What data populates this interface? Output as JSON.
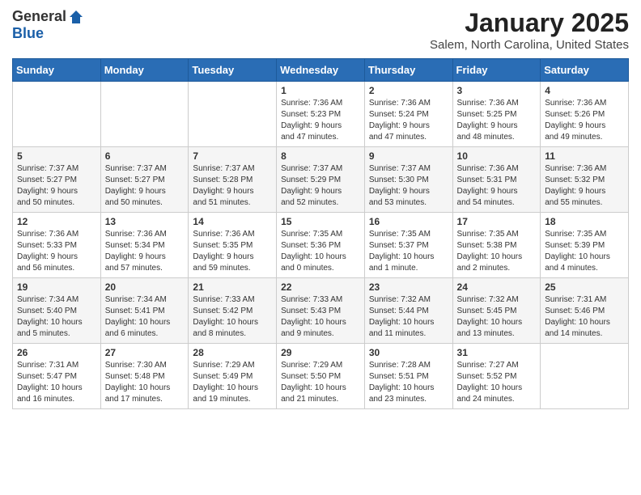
{
  "header": {
    "logo_general": "General",
    "logo_blue": "Blue",
    "month_title": "January 2025",
    "location": "Salem, North Carolina, United States"
  },
  "days_of_week": [
    "Sunday",
    "Monday",
    "Tuesday",
    "Wednesday",
    "Thursday",
    "Friday",
    "Saturday"
  ],
  "weeks": [
    [
      {
        "day": "",
        "info": ""
      },
      {
        "day": "",
        "info": ""
      },
      {
        "day": "",
        "info": ""
      },
      {
        "day": "1",
        "info": "Sunrise: 7:36 AM\nSunset: 5:23 PM\nDaylight: 9 hours\nand 47 minutes."
      },
      {
        "day": "2",
        "info": "Sunrise: 7:36 AM\nSunset: 5:24 PM\nDaylight: 9 hours\nand 47 minutes."
      },
      {
        "day": "3",
        "info": "Sunrise: 7:36 AM\nSunset: 5:25 PM\nDaylight: 9 hours\nand 48 minutes."
      },
      {
        "day": "4",
        "info": "Sunrise: 7:36 AM\nSunset: 5:26 PM\nDaylight: 9 hours\nand 49 minutes."
      }
    ],
    [
      {
        "day": "5",
        "info": "Sunrise: 7:37 AM\nSunset: 5:27 PM\nDaylight: 9 hours\nand 50 minutes."
      },
      {
        "day": "6",
        "info": "Sunrise: 7:37 AM\nSunset: 5:27 PM\nDaylight: 9 hours\nand 50 minutes."
      },
      {
        "day": "7",
        "info": "Sunrise: 7:37 AM\nSunset: 5:28 PM\nDaylight: 9 hours\nand 51 minutes."
      },
      {
        "day": "8",
        "info": "Sunrise: 7:37 AM\nSunset: 5:29 PM\nDaylight: 9 hours\nand 52 minutes."
      },
      {
        "day": "9",
        "info": "Sunrise: 7:37 AM\nSunset: 5:30 PM\nDaylight: 9 hours\nand 53 minutes."
      },
      {
        "day": "10",
        "info": "Sunrise: 7:36 AM\nSunset: 5:31 PM\nDaylight: 9 hours\nand 54 minutes."
      },
      {
        "day": "11",
        "info": "Sunrise: 7:36 AM\nSunset: 5:32 PM\nDaylight: 9 hours\nand 55 minutes."
      }
    ],
    [
      {
        "day": "12",
        "info": "Sunrise: 7:36 AM\nSunset: 5:33 PM\nDaylight: 9 hours\nand 56 minutes."
      },
      {
        "day": "13",
        "info": "Sunrise: 7:36 AM\nSunset: 5:34 PM\nDaylight: 9 hours\nand 57 minutes."
      },
      {
        "day": "14",
        "info": "Sunrise: 7:36 AM\nSunset: 5:35 PM\nDaylight: 9 hours\nand 59 minutes."
      },
      {
        "day": "15",
        "info": "Sunrise: 7:35 AM\nSunset: 5:36 PM\nDaylight: 10 hours\nand 0 minutes."
      },
      {
        "day": "16",
        "info": "Sunrise: 7:35 AM\nSunset: 5:37 PM\nDaylight: 10 hours\nand 1 minute."
      },
      {
        "day": "17",
        "info": "Sunrise: 7:35 AM\nSunset: 5:38 PM\nDaylight: 10 hours\nand 2 minutes."
      },
      {
        "day": "18",
        "info": "Sunrise: 7:35 AM\nSunset: 5:39 PM\nDaylight: 10 hours\nand 4 minutes."
      }
    ],
    [
      {
        "day": "19",
        "info": "Sunrise: 7:34 AM\nSunset: 5:40 PM\nDaylight: 10 hours\nand 5 minutes."
      },
      {
        "day": "20",
        "info": "Sunrise: 7:34 AM\nSunset: 5:41 PM\nDaylight: 10 hours\nand 6 minutes."
      },
      {
        "day": "21",
        "info": "Sunrise: 7:33 AM\nSunset: 5:42 PM\nDaylight: 10 hours\nand 8 minutes."
      },
      {
        "day": "22",
        "info": "Sunrise: 7:33 AM\nSunset: 5:43 PM\nDaylight: 10 hours\nand 9 minutes."
      },
      {
        "day": "23",
        "info": "Sunrise: 7:32 AM\nSunset: 5:44 PM\nDaylight: 10 hours\nand 11 minutes."
      },
      {
        "day": "24",
        "info": "Sunrise: 7:32 AM\nSunset: 5:45 PM\nDaylight: 10 hours\nand 13 minutes."
      },
      {
        "day": "25",
        "info": "Sunrise: 7:31 AM\nSunset: 5:46 PM\nDaylight: 10 hours\nand 14 minutes."
      }
    ],
    [
      {
        "day": "26",
        "info": "Sunrise: 7:31 AM\nSunset: 5:47 PM\nDaylight: 10 hours\nand 16 minutes."
      },
      {
        "day": "27",
        "info": "Sunrise: 7:30 AM\nSunset: 5:48 PM\nDaylight: 10 hours\nand 17 minutes."
      },
      {
        "day": "28",
        "info": "Sunrise: 7:29 AM\nSunset: 5:49 PM\nDaylight: 10 hours\nand 19 minutes."
      },
      {
        "day": "29",
        "info": "Sunrise: 7:29 AM\nSunset: 5:50 PM\nDaylight: 10 hours\nand 21 minutes."
      },
      {
        "day": "30",
        "info": "Sunrise: 7:28 AM\nSunset: 5:51 PM\nDaylight: 10 hours\nand 23 minutes."
      },
      {
        "day": "31",
        "info": "Sunrise: 7:27 AM\nSunset: 5:52 PM\nDaylight: 10 hours\nand 24 minutes."
      },
      {
        "day": "",
        "info": ""
      }
    ]
  ]
}
